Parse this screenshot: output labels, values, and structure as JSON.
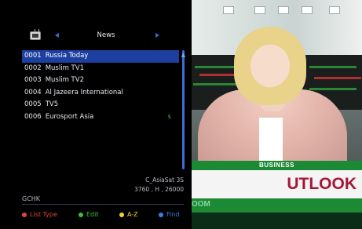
{
  "channel_list": {
    "group_title": "News",
    "channels": [
      {
        "num": "0001",
        "name": "Russia Today",
        "selected": true,
        "flag": ""
      },
      {
        "num": "0002",
        "name": "Muslim TV1",
        "selected": false,
        "flag": ""
      },
      {
        "num": "0003",
        "name": "Muslim TV2",
        "selected": false,
        "flag": ""
      },
      {
        "num": "0004",
        "name": "Al Jazeera International",
        "selected": false,
        "flag": ""
      },
      {
        "num": "0005",
        "name": "TV5",
        "selected": false,
        "flag": ""
      },
      {
        "num": "0006",
        "name": "Eurosport Asia",
        "selected": false,
        "flag": "$"
      }
    ],
    "satellite": "C_AsiaSat 3S",
    "transponder": "3760 , H , 26000",
    "status": "GCHK"
  },
  "footer": {
    "buttons": [
      {
        "label": "List Type",
        "color": "#e0453a",
        "text_color": "#e0453a"
      },
      {
        "label": "Edit",
        "color": "#3fbf3a",
        "text_color": "#3fbf3a"
      },
      {
        "label": "A-Z",
        "color": "#e8d53a",
        "text_color": "#e8d53a"
      },
      {
        "label": "Find",
        "color": "#3a7fe8",
        "text_color": "#3a7fe8"
      }
    ]
  },
  "video": {
    "lower_third_label": "BUSINESS",
    "headline": "UTLOOK",
    "subline": "OOM"
  },
  "colors": {
    "selection": "#1d3fa0",
    "accent_blue": "#2f6fe0"
  }
}
